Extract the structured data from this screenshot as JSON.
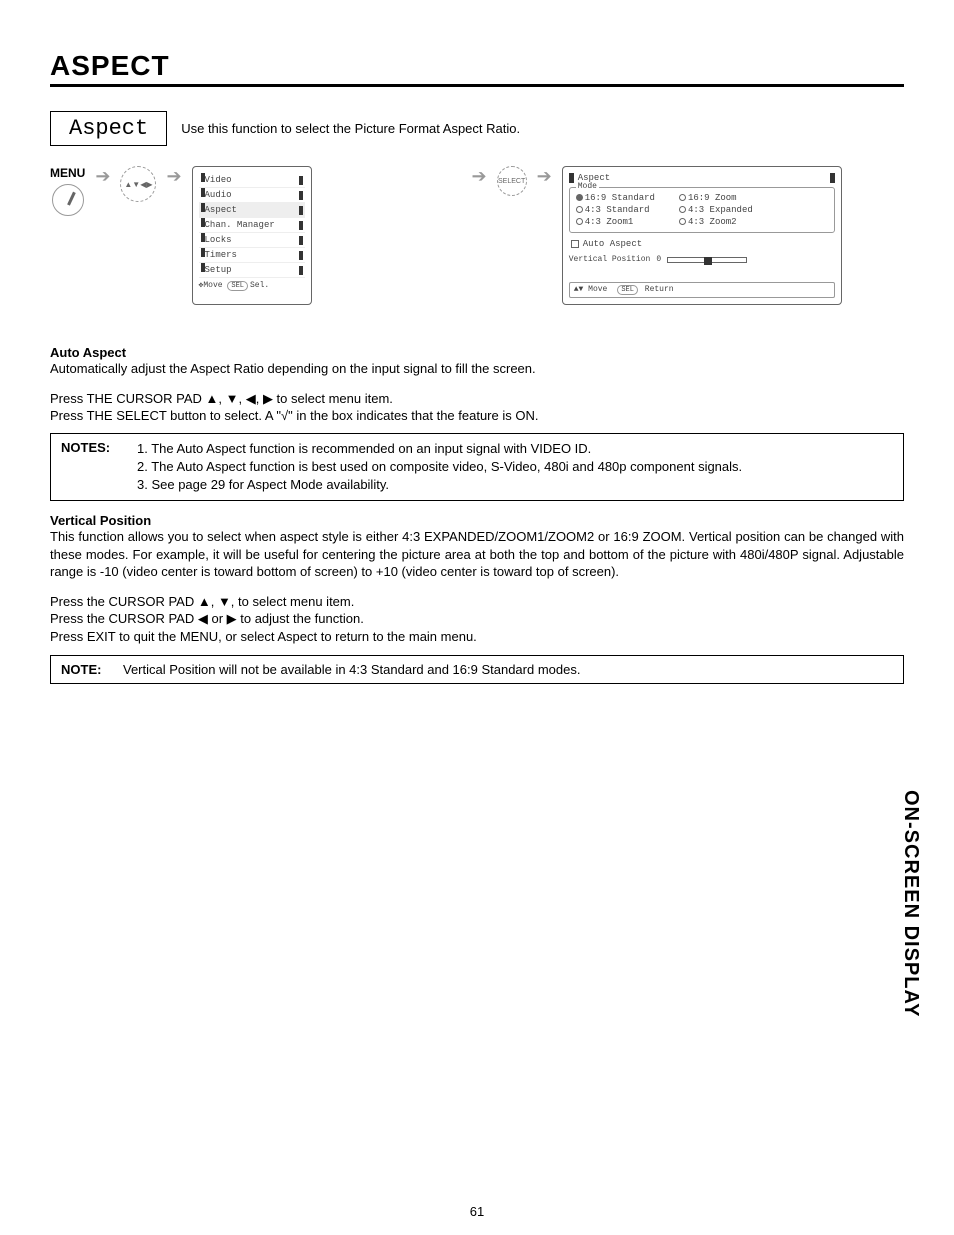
{
  "title": "ASPECT",
  "aspect_label": "Aspect",
  "intro": "Use this function to select the Picture Format Aspect Ratio.",
  "menu_label": "MENU",
  "cursor_pad_icon": "⊕",
  "select_icon": "SELECT",
  "main_menu": {
    "items": [
      "Video",
      "Audio",
      "Aspect",
      "Chan. Manager",
      "Locks",
      "Timers",
      "Setup"
    ],
    "footer_move": "Move",
    "footer_sel": "Sel.",
    "sel_pill": "SEL"
  },
  "aspect_menu": {
    "title": "Aspect",
    "group": "Mode",
    "col1": [
      "16:9 Standard",
      "4:3 Standard",
      "4:3 Zoom1"
    ],
    "col2": [
      "16:9 Zoom",
      "4:3 Expanded",
      "4:3 Zoom2"
    ],
    "auto_aspect": "Auto Aspect",
    "vpos_label": "Vertical Position",
    "vpos_val": "0",
    "footer_move": "Move",
    "footer_return": "Return",
    "sel_pill": "SEL"
  },
  "auto_aspect": {
    "heading": "Auto Aspect",
    "body": "Automatically adjust the Aspect Ratio depending on the input signal to fill the screen.",
    "p1": "Press THE CURSOR PAD ▲, ▼, ◀, ▶ to select menu item.",
    "p2": "Press THE SELECT button to select.  A \"√\" in the box indicates that the feature is ON."
  },
  "notes1": {
    "label": "NOTES:",
    "items": [
      "1. The Auto Aspect function is recommended on an input signal with VIDEO ID.",
      "2. The Auto Aspect function is best used on composite video, S-Video, 480i and 480p component signals.",
      "3. See page 29 for Aspect Mode availability."
    ]
  },
  "vpos": {
    "heading": "Vertical Position",
    "body": "This function allows you to select when aspect style is either 4:3 EXPANDED/ZOOM1/ZOOM2 or 16:9 ZOOM.  Vertical position can be changed with these modes.  For example, it will be useful for centering the picture area at both the top and bottom of the picture with 480i/480P signal.  Adjustable range is -10 (video center is toward bottom of screen) to +10 (video center is toward top of screen).",
    "p1": "Press the CURSOR PAD ▲, ▼, to select menu item.",
    "p2": "Press the CURSOR PAD  ◀ or ▶ to adjust the function.",
    "p3": "Press EXIT to quit the MENU, or select Aspect to return to the main menu."
  },
  "note2": {
    "label": "NOTE:",
    "text": "Vertical Position will not be available in 4:3 Standard and 16:9 Standard modes."
  },
  "side_tab": "ON-SCREEN DISPLAY",
  "page_num": "61"
}
